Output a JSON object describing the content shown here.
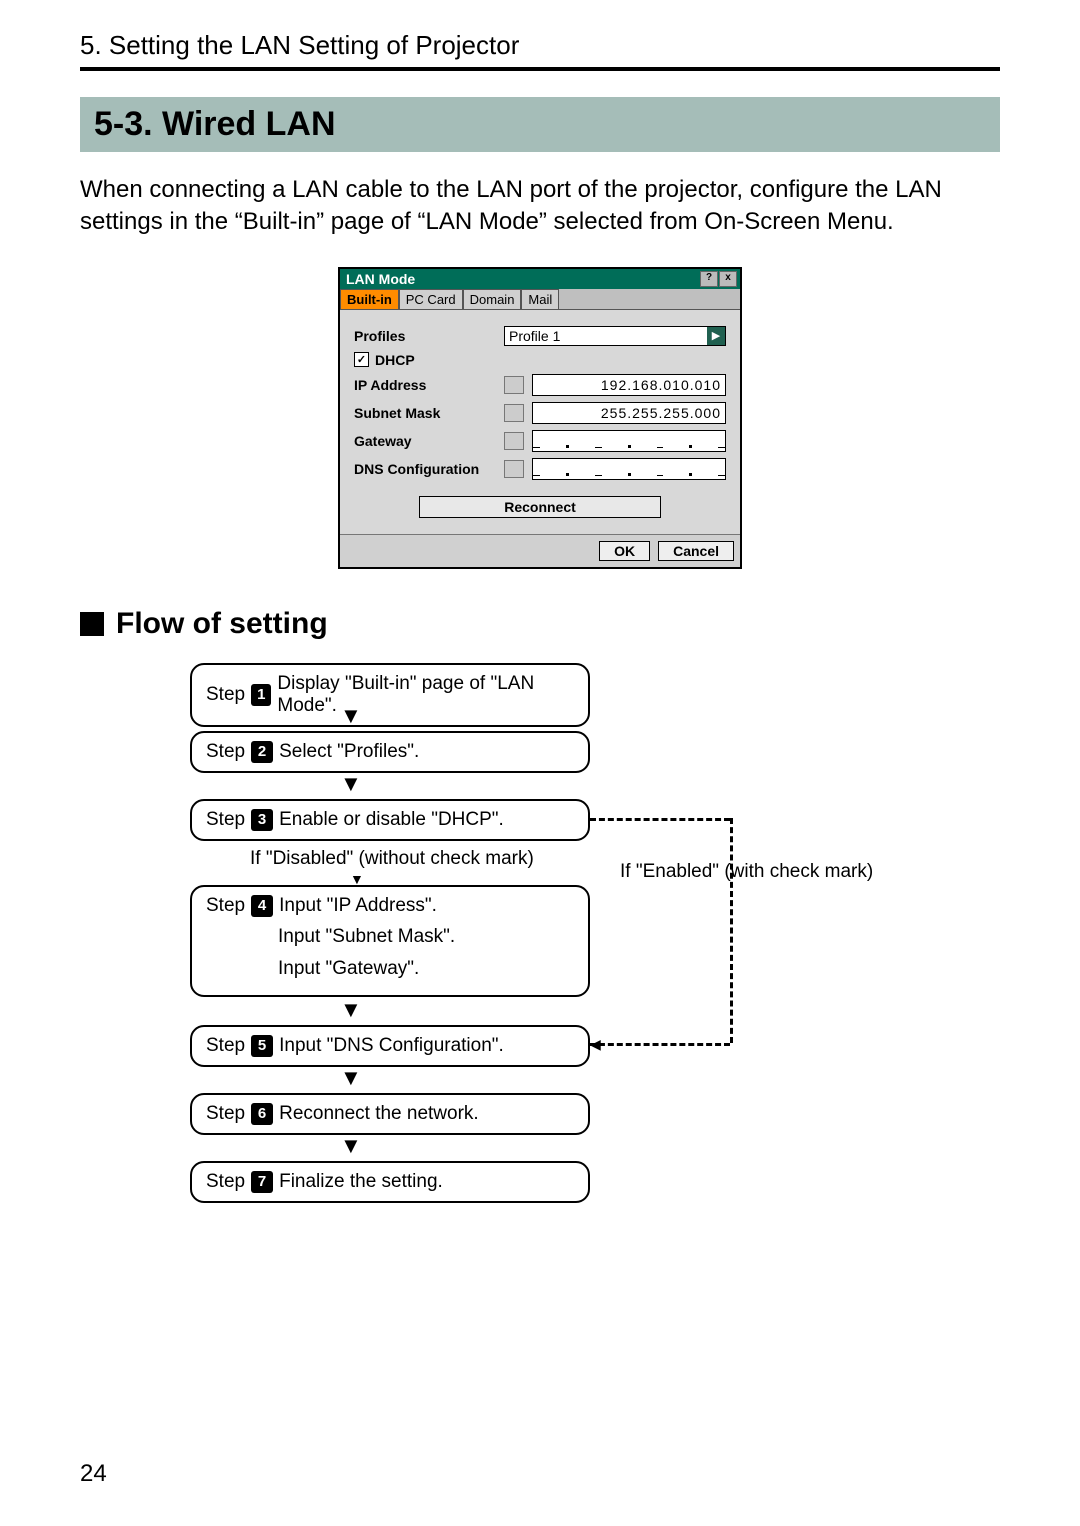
{
  "chapter": "5. Setting the LAN Setting of Projector",
  "section_number": "5-3.",
  "section_title": "Wired LAN",
  "intro": "When connecting a LAN cable to the LAN port of the projector, configure the LAN settings in the “Built-in” page of “LAN Mode” selected from On-Screen Menu.",
  "dialog": {
    "title": "LAN Mode",
    "tabs": [
      "Built-in",
      "PC Card",
      "Domain",
      "Mail"
    ],
    "profiles_label": "Profiles",
    "profile_value": "Profile 1",
    "dhcp_label": "DHCP",
    "dhcp_checked": "✓",
    "ip_label": "IP Address",
    "ip_value": "192.168.010.010",
    "subnet_label": "Subnet Mask",
    "subnet_value": "255.255.255.000",
    "gateway_label": "Gateway",
    "dns_label": "DNS Configuration",
    "reconnect": "Reconnect",
    "ok": "OK",
    "cancel": "Cancel"
  },
  "flow_heading": "Flow of setting",
  "steps": {
    "s1": {
      "pre": "Step",
      "num": "1",
      "text": "Display \"Built-in\" page of \"LAN Mode\"."
    },
    "s2": {
      "pre": "Step",
      "num": "2",
      "text": "Select \"Profiles\"."
    },
    "s3": {
      "pre": "Step",
      "num": "3",
      "text": "Enable or disable \"DHCP\"."
    },
    "s4": {
      "pre": "Step",
      "num": "4",
      "text": "Input \"IP Address\"."
    },
    "s4b": "Input \"Subnet Mask\".",
    "s4c": "Input \"Gateway\".",
    "s5": {
      "pre": "Step",
      "num": "5",
      "text": "Input \"DNS Configuration\"."
    },
    "s6": {
      "pre": "Step",
      "num": "6",
      "text": "Reconnect the network."
    },
    "s7": {
      "pre": "Step",
      "num": "7",
      "text": "Finalize the setting."
    }
  },
  "branch": {
    "disabled": "If \"Disabled\" (without check mark)",
    "enabled": "If \"Enabled\" (with check mark)"
  },
  "page_number": "24"
}
